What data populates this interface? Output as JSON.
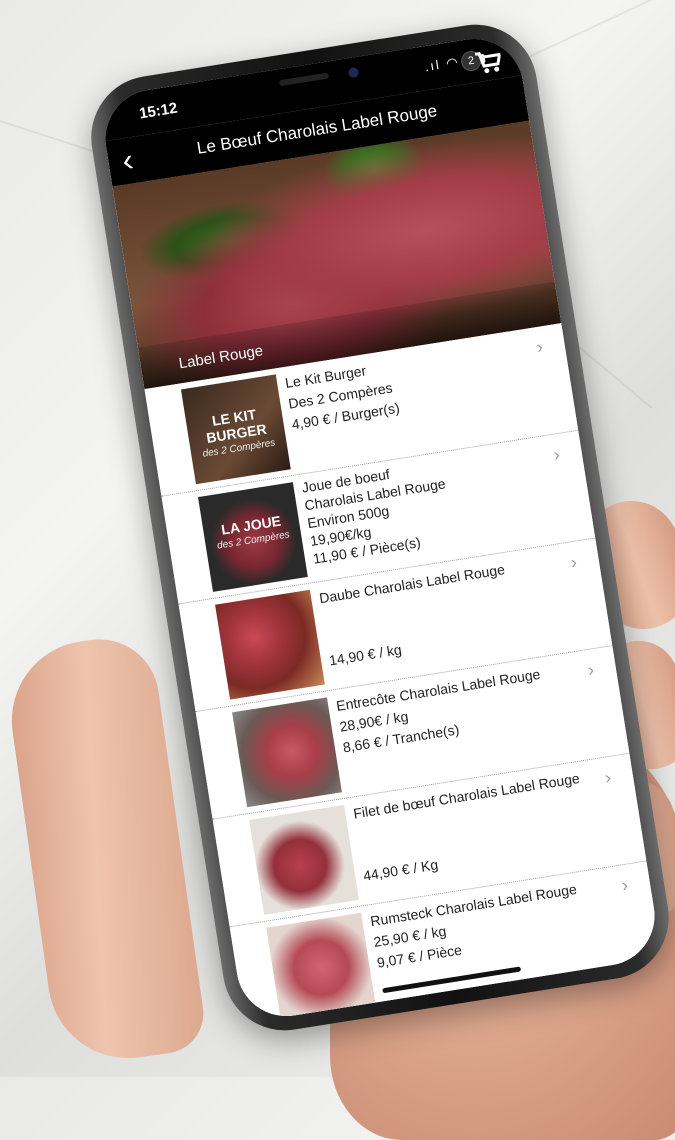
{
  "status_bar": {
    "time": "15:12",
    "signal": ".ıl",
    "wifi": "◠"
  },
  "nav": {
    "back_icon": "‹",
    "title": "Le Bœuf Charolais Label Rouge",
    "cart_count": "2"
  },
  "hero": {
    "label": "Label Rouge"
  },
  "products": [
    {
      "lines": [
        "Le Kit Burger",
        "Des 2 Compères",
        "4,90 € / Burger(s)"
      ],
      "thumb_title": "LE KIT BURGER",
      "thumb_sub": "des 2 Compères",
      "chevron": "›"
    },
    {
      "lines": [
        "Joue de boeuf",
        "Charolais Label Rouge",
        "Environ 500g",
        "19,90€/kg",
        "11,90 € / Pièce(s)"
      ],
      "thumb_title": "LA JOUE",
      "thumb_sub": "des 2 Compères",
      "chevron": "›"
    },
    {
      "lines": [
        "Daube Charolais Label Rouge",
        "",
        "14,90 € / kg"
      ],
      "thumb_title": "",
      "thumb_sub": "",
      "chevron": "›"
    },
    {
      "lines": [
        "Entrecôte Charolais Label Rouge",
        "28,90€ / kg",
        "8,66 € / Tranche(s)"
      ],
      "thumb_title": "",
      "thumb_sub": "",
      "chevron": "›"
    },
    {
      "lines": [
        "Filet de bœuf Charolais Label Rouge",
        "",
        "44,90 € / Kg"
      ],
      "thumb_title": "",
      "thumb_sub": "",
      "chevron": "›"
    },
    {
      "lines": [
        "Rumsteck Charolais Label Rouge",
        "25,90 € / kg",
        "9,07 € / Pièce"
      ],
      "thumb_title": "",
      "thumb_sub": "",
      "chevron": "›"
    }
  ]
}
